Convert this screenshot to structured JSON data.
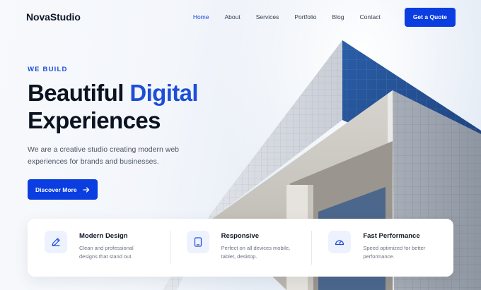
{
  "brand": {
    "name": "NovaStudio"
  },
  "nav": {
    "links": [
      {
        "label": "Home",
        "active": true
      },
      {
        "label": "About",
        "active": false
      },
      {
        "label": "Services",
        "active": false
      },
      {
        "label": "Portfolio",
        "active": false
      },
      {
        "label": "Blog",
        "active": false
      },
      {
        "label": "Contact",
        "active": false
      }
    ],
    "cta_label": "Get a Quote"
  },
  "hero": {
    "eyebrow": "WE BUILD",
    "headline_part1": "Beautiful",
    "headline_accent": "Digital",
    "headline_part2": "Experiences",
    "lede": "We are a creative studio creating modern web experiences for brands and businesses.",
    "button_label": "Discover More",
    "button_icon": "arrow-right-icon"
  },
  "features": [
    {
      "icon": "pen-icon",
      "title": "Modern Design",
      "desc": "Clean and professional designs that stand out."
    },
    {
      "icon": "tablet-icon",
      "title": "Responsive",
      "desc": "Perfect on all devices mobile, tablet, desktop."
    },
    {
      "icon": "gauge-icon",
      "title": "Fast Performance",
      "desc": "Speed optimized for better performance."
    }
  ],
  "colors": {
    "accent": "#1d4ed8",
    "button": "#0b3ee0",
    "heading": "#0b1220"
  }
}
